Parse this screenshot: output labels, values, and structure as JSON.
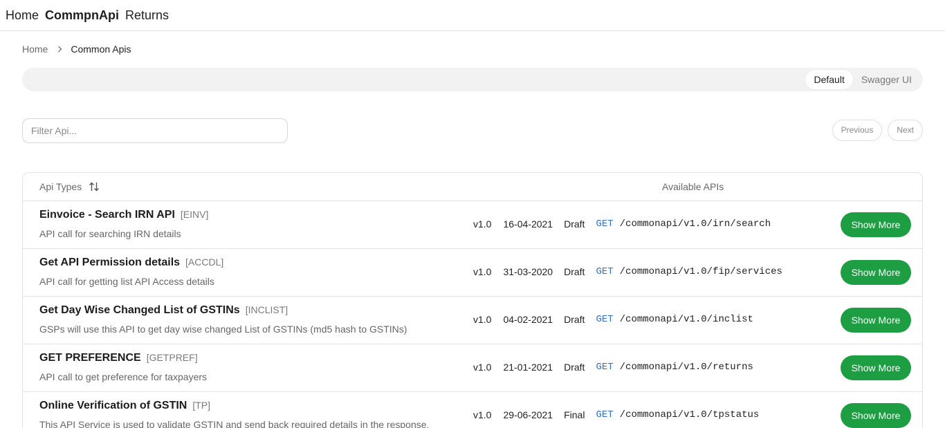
{
  "topnav": {
    "items": [
      "Home",
      "CommpnApi",
      "Returns"
    ]
  },
  "breadcrumb": {
    "home": "Home",
    "current": "Common Apis"
  },
  "view_toggle": {
    "options": [
      "Default",
      "Swagger UI"
    ],
    "selected": "Default"
  },
  "filter": {
    "placeholder": "Filter Api...",
    "value": ""
  },
  "pager": {
    "previous": "Previous",
    "next": "Next"
  },
  "table": {
    "headers": {
      "types": "Api Types",
      "available": "Available APIs"
    },
    "rows": [
      {
        "name": "Einvoice - Search IRN API",
        "code": "[EINV]",
        "desc": "API call for searching IRN details",
        "version": "v1.0",
        "date": "16-04-2021",
        "status": "Draft",
        "method": "GET",
        "path": "/commonapi/v1.0/irn/search",
        "action": "Show More"
      },
      {
        "name": "Get API Permission details",
        "code": "[ACCDL]",
        "desc": "API call for getting list API Access details",
        "version": "v1.0",
        "date": "31-03-2020",
        "status": "Draft",
        "method": "GET",
        "path": "/commonapi/v1.0/fip/services",
        "action": "Show More"
      },
      {
        "name": "Get Day Wise Changed List of GSTINs",
        "code": "[INCLIST]",
        "desc": "GSPs will use this API to get day wise changed List of GSTINs (md5 hash to GSTINs)",
        "version": "v1.0",
        "date": "04-02-2021",
        "status": "Draft",
        "method": "GET",
        "path": "/commonapi/v1.0/inclist",
        "action": "Show More"
      },
      {
        "name": "GET PREFERENCE",
        "code": "[GETPREF]",
        "desc": "API call to get preference for taxpayers",
        "version": "v1.0",
        "date": "21-01-2021",
        "status": "Draft",
        "method": "GET",
        "path": "/commonapi/v1.0/returns",
        "action": "Show More"
      },
      {
        "name": "Online Verification of GSTIN",
        "code": "[TP]",
        "desc": "This API Service is used to validate GSTIN and send back required details in the response.",
        "version": "v1.0",
        "date": "29-06-2021",
        "status": "Final",
        "method": "GET",
        "path": "/commonapi/v1.0/tpstatus",
        "action": "Show More"
      }
    ]
  },
  "colors": {
    "primary_button": "#1e9e43",
    "method": "#2e6fd9"
  },
  "icons": {
    "breadcrumb_separator": "chevron-right-icon",
    "sort": "sort-icon"
  }
}
